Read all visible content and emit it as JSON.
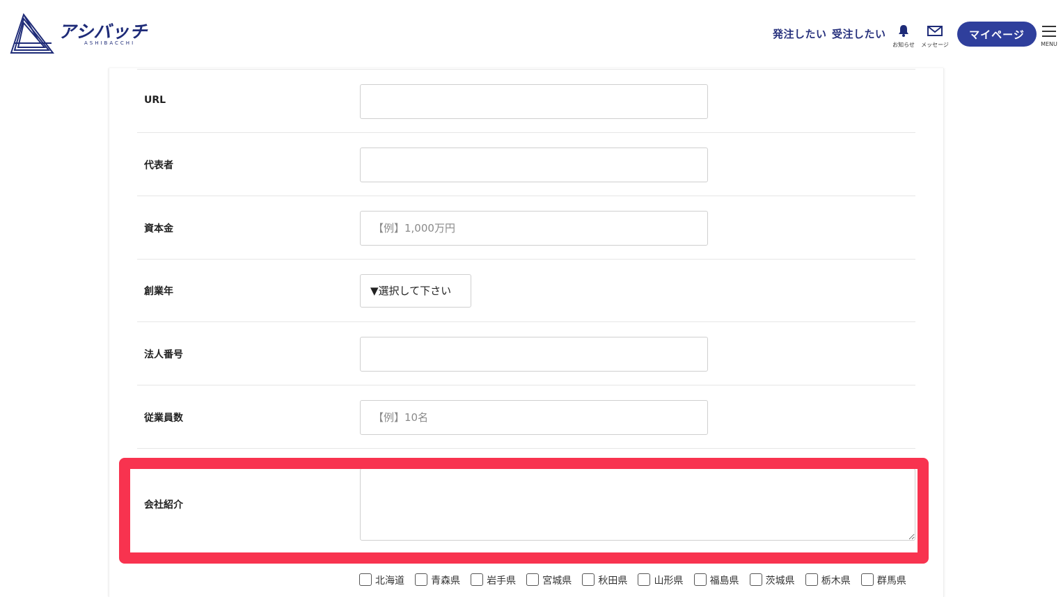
{
  "header": {
    "logo_text": "アシバッチ",
    "logo_sub": "ASHIBACCHI",
    "nav": {
      "order": "発注したい",
      "receive": "受注したい"
    },
    "notice_label": "お知らせ",
    "message_label": "メッセージ",
    "mypage_label": "マイページ",
    "menu_label": "MENU"
  },
  "form": {
    "fields": [
      {
        "label": "URL",
        "placeholder": ""
      },
      {
        "label": "代表者",
        "placeholder": ""
      },
      {
        "label": "資本金",
        "placeholder": "【例】1,000万円"
      },
      {
        "label": "創業年",
        "select_value": "▼選択して下さい"
      },
      {
        "label": "法人番号",
        "placeholder": ""
      },
      {
        "label": "従業員数",
        "placeholder": "【例】10名"
      },
      {
        "label": "会社紹介",
        "placeholder": ""
      }
    ],
    "prefectures": [
      "北海道",
      "青森県",
      "岩手県",
      "宮城県",
      "秋田県",
      "山形県",
      "福島県",
      "茨城県",
      "栃木県",
      "群馬県"
    ]
  },
  "colors": {
    "brand": "#1e2b78",
    "mypage_button": "#2f3f9c",
    "highlight": "#f8334f"
  },
  "icons": [
    "logo-icon",
    "bell-icon",
    "envelope-icon",
    "hamburger-menu-icon"
  ]
}
